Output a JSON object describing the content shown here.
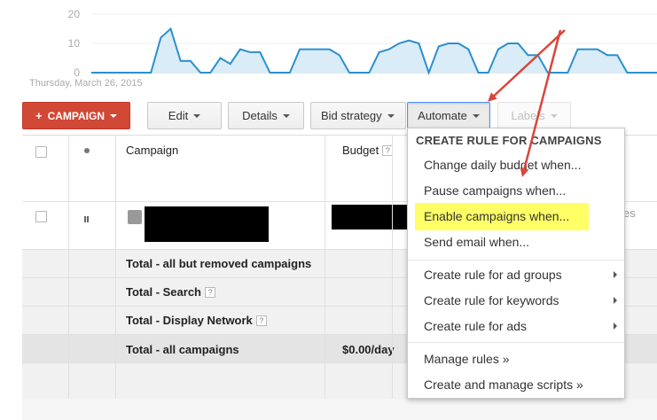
{
  "chart": {
    "date_label": "Thursday, March 26, 2015",
    "y_ticks": [
      "20",
      "10",
      "0"
    ]
  },
  "chart_data": {
    "type": "area",
    "ylim": [
      0,
      20
    ],
    "y_ticks": [
      0,
      10,
      20
    ],
    "values": [
      0,
      0,
      0,
      0,
      0,
      0,
      0,
      12,
      15,
      4,
      4,
      0,
      0,
      5,
      3,
      8,
      7,
      7,
      0,
      0,
      0,
      8,
      8,
      8,
      8,
      6,
      0,
      0,
      0,
      7,
      8,
      10,
      11,
      10,
      0,
      9,
      10,
      10,
      8,
      0,
      0,
      8,
      10,
      10,
      6,
      6,
      0,
      0,
      0,
      8,
      8,
      8,
      6,
      6,
      0,
      0,
      0,
      0
    ],
    "color": "#2b8fce",
    "fill": "#d9ecf8"
  },
  "toolbar": {
    "campaign_label": "CAMPAIGN",
    "edit_label": "Edit",
    "details_label": "Details",
    "bid_strategy_label": "Bid strategy",
    "automate_label": "Automate",
    "labels_label": "Labels"
  },
  "table": {
    "col_campaign": "Campaign",
    "col_budget": "Budget",
    "help_glyph": "?",
    "totals": [
      {
        "label": "Total - all but removed campaigns",
        "help": false,
        "budget": ""
      },
      {
        "label": "Total - Search",
        "help": true,
        "budget": ""
      },
      {
        "label": "Total - Display Network",
        "help": true,
        "budget": ""
      },
      {
        "label": "Total - all campaigns",
        "help": false,
        "budget": "$0.00/day"
      }
    ],
    "partial_text": "es"
  },
  "menu": {
    "title": "CREATE RULE FOR CAMPAIGNS",
    "items": [
      "Change daily budget when...",
      "Pause campaigns when...",
      "Enable campaigns when...",
      "Send email when...",
      "Create rule for ad groups",
      "Create rule for keywords",
      "Create rule for ads",
      "Manage rules »",
      "Create and manage scripts »"
    ]
  },
  "colors": {
    "campaign_button": "#d14836",
    "highlight": "#ffff66",
    "arrow": "#d9453a",
    "chart_line": "#2b8fce"
  }
}
